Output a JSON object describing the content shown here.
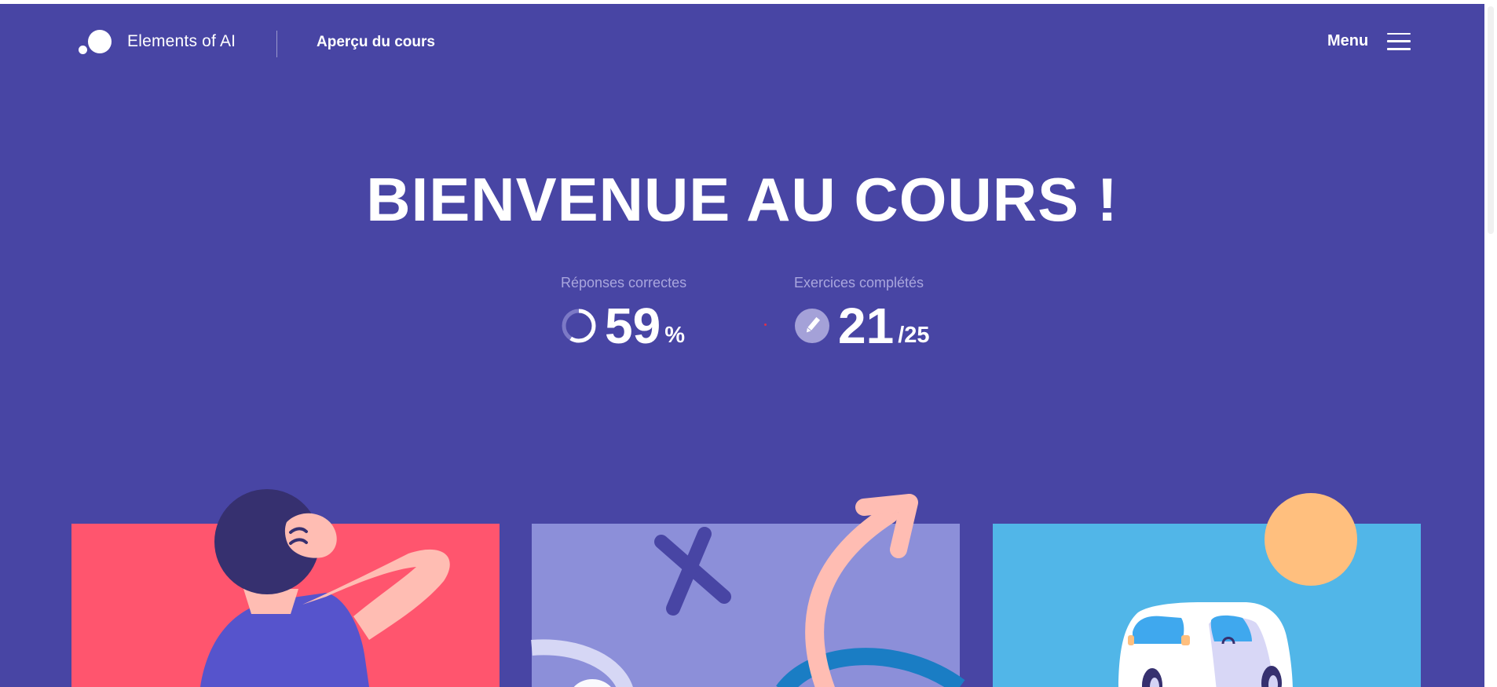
{
  "header": {
    "brand": "Elements of AI",
    "nav_link": "Aperçu du cours",
    "menu_label": "Menu"
  },
  "hero": {
    "title": "BIENVENUE AU COURS !"
  },
  "stats": {
    "correct_answers": {
      "label": "Réponses correctes",
      "value": "59",
      "suffix": "%",
      "fraction": 0.59
    },
    "completed_exercises": {
      "label": "Exercices complétés",
      "value": "21",
      "suffix": "/25"
    }
  },
  "cards": [
    {
      "name": "chapter-card-1",
      "color": "#ff556e",
      "illustration": "thinking-person"
    },
    {
      "name": "chapter-card-2",
      "color": "#8c8fd9",
      "illustration": "path-arrow"
    },
    {
      "name": "chapter-card-3",
      "color": "#51b6e8",
      "illustration": "self-driving-car"
    }
  ],
  "colors": {
    "background": "#4845a4",
    "text": "#ffffff",
    "muted_label": "#a9a6de"
  },
  "icons": {
    "logo": "dots-logo",
    "menu": "hamburger-icon",
    "correct": "progress-ring-icon",
    "exercises": "pencil-icon"
  }
}
